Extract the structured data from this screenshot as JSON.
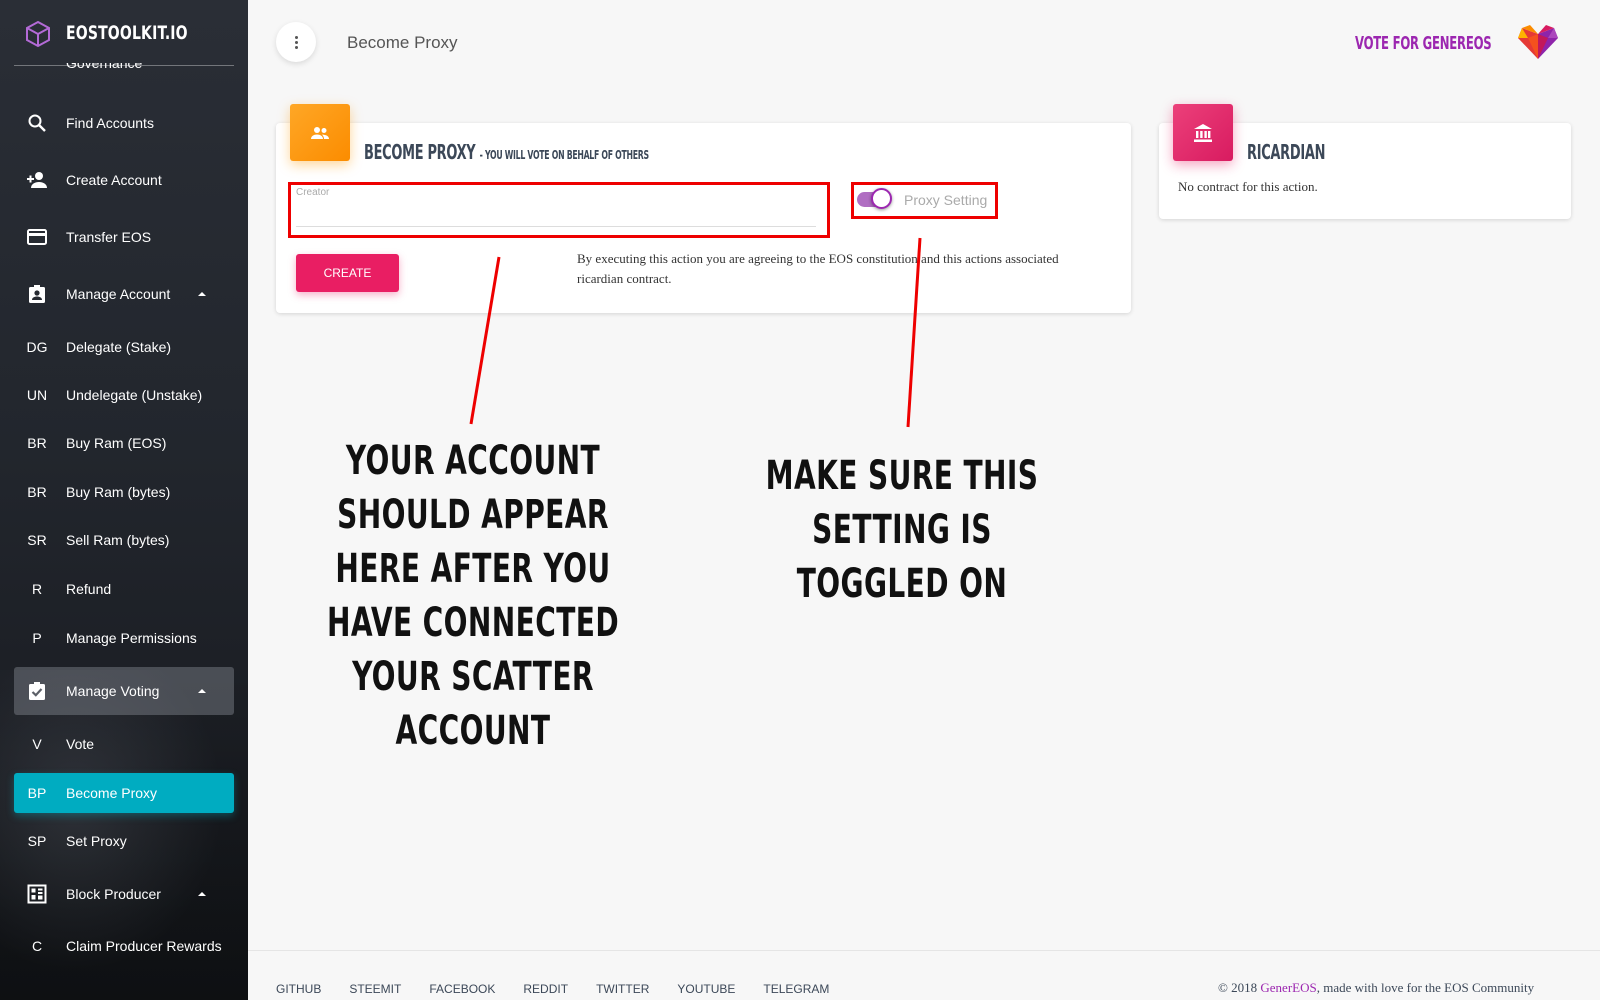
{
  "app": {
    "brand": "EOSTOOLKIT.IO",
    "page_title": "Become Proxy",
    "vote_link": "VOTE FOR GENEREOS"
  },
  "sidebar": {
    "partial_item": "Governance",
    "items": [
      {
        "label": "Find Accounts",
        "icon": "search-icon"
      },
      {
        "label": "Create Account",
        "icon": "add-person-icon"
      },
      {
        "label": "Transfer EOS",
        "icon": "credit-card-icon"
      },
      {
        "label": "Manage Account",
        "icon": "badge-icon"
      },
      {
        "abbr": "DG",
        "label": "Delegate (Stake)"
      },
      {
        "abbr": "UN",
        "label": "Undelegate (Unstake)"
      },
      {
        "abbr": "BR",
        "label": "Buy Ram (EOS)"
      },
      {
        "abbr": "BR",
        "label": "Buy Ram (bytes)"
      },
      {
        "abbr": "SR",
        "label": "Sell Ram (bytes)"
      },
      {
        "abbr": "R",
        "label": "Refund"
      },
      {
        "abbr": "P",
        "label": "Manage Permissions"
      },
      {
        "label": "Manage Voting",
        "icon": "clipboard-check-icon"
      },
      {
        "abbr": "V",
        "label": "Vote"
      },
      {
        "abbr": "BP",
        "label": "Become Proxy"
      },
      {
        "abbr": "SP",
        "label": "Set Proxy"
      },
      {
        "label": "Block Producer",
        "icon": "dashboard-icon"
      },
      {
        "abbr": "C",
        "label": "Claim Producer Rewards"
      }
    ]
  },
  "proxy_card": {
    "title": "BECOME PROXY",
    "subtitle": "- YOU WILL VOTE ON BEHALF OF OTHERS",
    "creator_label": "Creator",
    "creator_value": "",
    "toggle_label": "Proxy Setting",
    "toggle_on": true,
    "create_button": "CREATE",
    "agreement": "By executing this action you are agreeing to the EOS constitution and this actions associated ricardian contract."
  },
  "ricardian_card": {
    "title": "RICARDIAN",
    "text": "No contract for this action."
  },
  "annotations": {
    "left": "YOUR ACCOUNT SHOULD APPEAR HERE AFTER YOU HAVE CONNECTED YOUR SCATTER ACCOUNT",
    "right": "MAKE SURE THIS SETTING IS TOGGLED ON"
  },
  "footer": {
    "links": [
      "GITHUB",
      "STEEMIT",
      "FACEBOOK",
      "REDDIT",
      "TWITTER",
      "YOUTUBE",
      "TELEGRAM"
    ],
    "copyright_prefix": "© 2018 ",
    "copyright_brand": "GenerEOS",
    "copyright_suffix": ", made with love for the EOS Community"
  },
  "colors": {
    "accent_active": "#00acc1",
    "vote_purple": "#9c27b0",
    "create_pink": "#e91e63",
    "proxy_orange": "#fb8c00",
    "annotation_red": "#e00000"
  }
}
